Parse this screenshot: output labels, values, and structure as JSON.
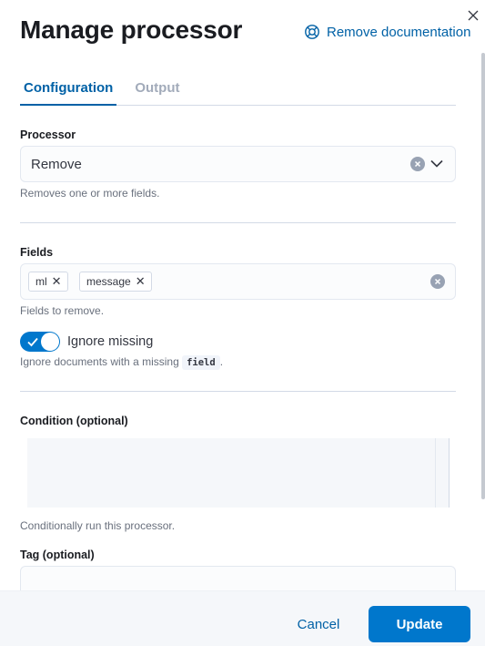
{
  "header": {
    "title": "Manage processor",
    "doc_link_label": "Remove documentation",
    "doc_link_icon": "lifebuoy-icon",
    "close_icon": "close-icon"
  },
  "tabs": [
    {
      "label": "Configuration",
      "active": true
    },
    {
      "label": "Output",
      "active": false
    }
  ],
  "processor": {
    "label": "Processor",
    "value": "Remove",
    "help": "Removes one or more fields."
  },
  "fields": {
    "label": "Fields",
    "values": [
      "ml",
      "message"
    ],
    "help": "Fields to remove."
  },
  "ignore_missing": {
    "label": "Ignore missing",
    "checked": true,
    "help_prefix": "Ignore documents with a missing ",
    "help_code": "field",
    "help_suffix": "."
  },
  "condition": {
    "label": "Condition (optional)",
    "value": "",
    "help": "Conditionally run this processor."
  },
  "tag": {
    "label": "Tag (optional)",
    "value": ""
  },
  "footer": {
    "cancel_label": "Cancel",
    "update_label": "Update"
  },
  "colors": {
    "accent": "#0077cc",
    "link": "#0061a6",
    "footer_bg": "#f5f7fa"
  }
}
